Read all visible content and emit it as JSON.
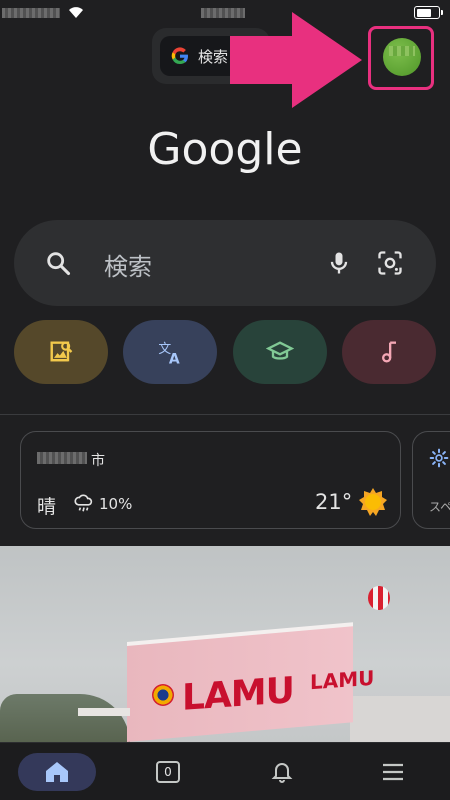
{
  "status_bar": {
    "battery_icon": "battery-icon",
    "wifi_icon": "wifi-icon"
  },
  "top_chip": {
    "label": "検索",
    "icon": "google-g-icon"
  },
  "logo": {
    "text": "Google"
  },
  "search": {
    "placeholder": "検索",
    "icons": [
      "search-icon",
      "mic-icon",
      "lens-icon"
    ]
  },
  "quick_actions": [
    {
      "icon": "image-search-icon",
      "color": "#55482a"
    },
    {
      "icon": "translate-icon",
      "color": "#37415b"
    },
    {
      "icon": "school-icon",
      "color": "#28433a"
    },
    {
      "icon": "music-note-icon",
      "color": "#4a2a31"
    }
  ],
  "weather": {
    "city_suffix": "市",
    "condition": "晴",
    "precip": "10%",
    "temperature": "21°"
  },
  "side_card": {
    "text": "スペ"
  },
  "photo": {
    "sign_large": "LAMU",
    "sign_small": "LAMU"
  },
  "nav": {
    "tabs_count": "0"
  },
  "colors": {
    "highlight": "#e8307f",
    "background": "#1f1f21"
  }
}
